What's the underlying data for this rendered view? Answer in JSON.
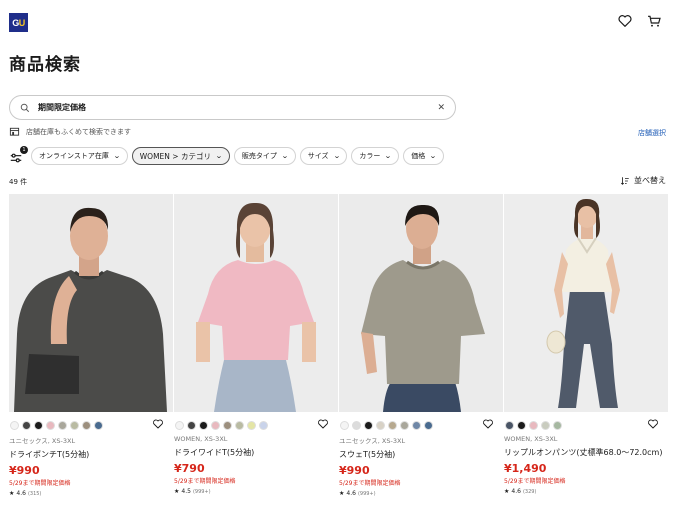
{
  "header": {
    "logo": "GU"
  },
  "page_title": "商品検索",
  "search": {
    "value": "期間限定価格"
  },
  "store_option": {
    "label": "店舗在庫もふくめて検索できます",
    "link": "店舗選択"
  },
  "filters": {
    "badge": "1",
    "chips": [
      {
        "label": "オンラインストア在庫",
        "active": false
      },
      {
        "label": "WOMEN > カテゴリ",
        "active": true
      },
      {
        "label": "販売タイプ",
        "active": false
      },
      {
        "label": "サイズ",
        "active": false
      },
      {
        "label": "カラー",
        "active": false
      },
      {
        "label": "価格",
        "active": false
      }
    ]
  },
  "results": {
    "count": "49 件",
    "sort_label": "並べ替え"
  },
  "products": [
    {
      "swatches": [
        "#f4f4f4",
        "#444444",
        "#1b1b1b",
        "#e8b9bf",
        "#a9a79b",
        "#b9bba3",
        "#9c8f7e",
        "#4a6b8f"
      ],
      "meta": "ユニセックス, XS-3XL",
      "name": "ドライポンチT(5分袖)",
      "price": "¥990",
      "promo": "5/29まで期間限定価格",
      "rating": "4.6",
      "reviews": "(315)"
    },
    {
      "swatches": [
        "#f4f4f4",
        "#444444",
        "#1b1b1b",
        "#e8b9bf",
        "#9c8f7e",
        "#b9bba3",
        "#e4e5a5",
        "#c9d3ea"
      ],
      "meta": "WOMEN, XS-3XL",
      "name": "ドライワイドT(5分袖)",
      "price": "¥790",
      "promo": "5/29まで期間限定価格",
      "rating": "4.5",
      "reviews": "(999+)"
    },
    {
      "swatches": [
        "#f4f4f4",
        "#dcdcdc",
        "#1b1b1b",
        "#d8d2c6",
        "#b7a98f",
        "#a9a79b",
        "#6f87a6",
        "#4a6b8f"
      ],
      "meta": "ユニセックス, XS-3XL",
      "name": "スウェT(5分袖)",
      "price": "¥990",
      "promo": "5/29まで期間限定価格",
      "rating": "4.6",
      "reviews": "(999+)"
    },
    {
      "swatches": [
        "#4a5566",
        "#1b1b1b",
        "#e8b9bf",
        "#c9ccbf",
        "#a6b8a1"
      ],
      "meta": "WOMEN, XS-3XL",
      "name": "リップルオンパンツ(丈標準68.0〜72.0cm)",
      "price": "¥1,490",
      "promo": "5/29まで期間限定価格",
      "rating": "4.6",
      "reviews": "(329)"
    }
  ]
}
